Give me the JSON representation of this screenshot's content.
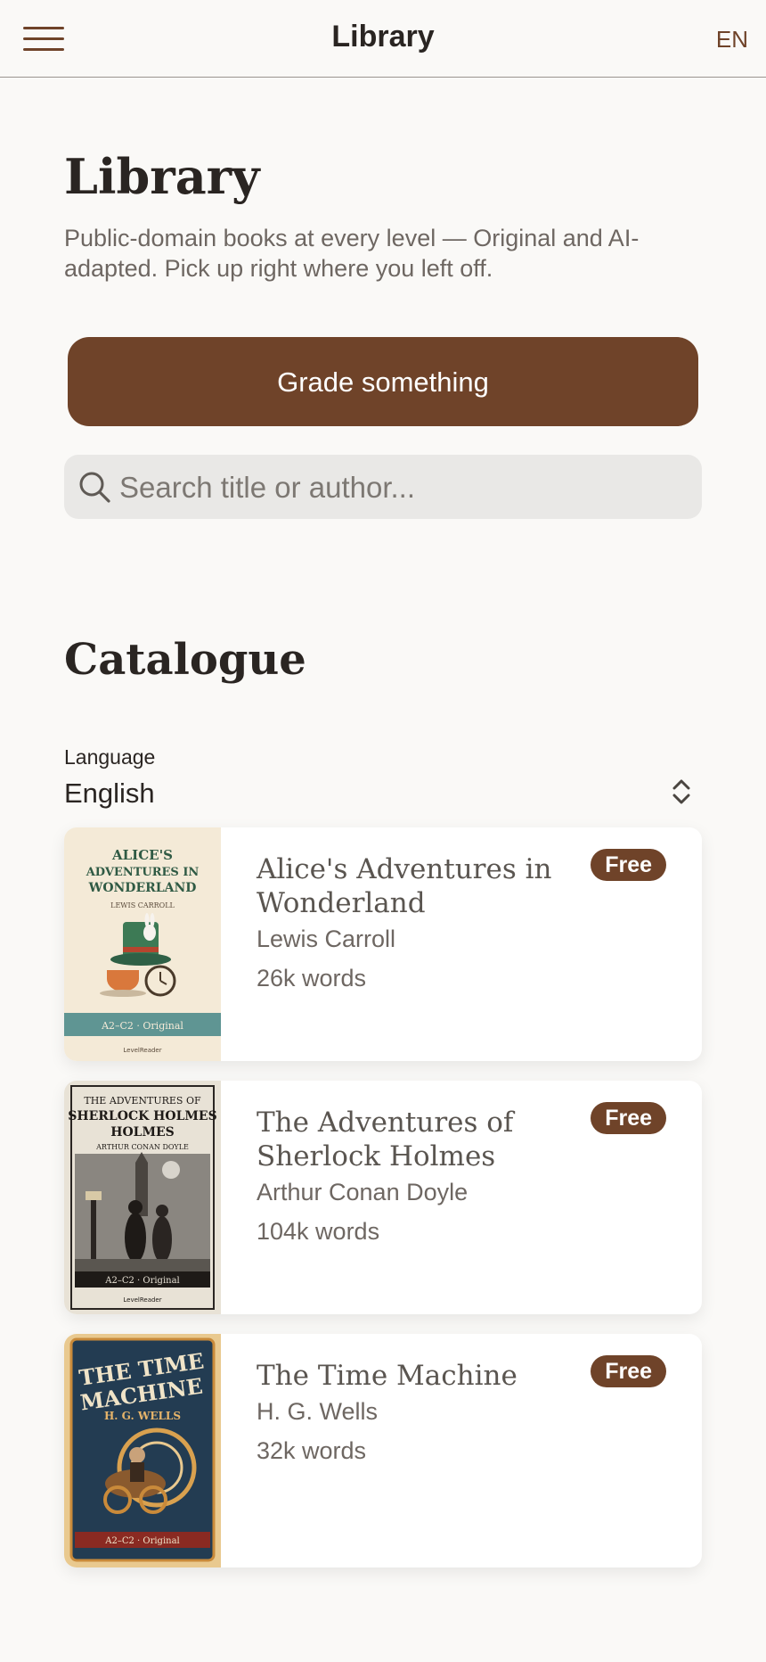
{
  "header": {
    "title": "Library",
    "language_code": "EN"
  },
  "intro": {
    "title": "Library",
    "subtitle": "Public-domain books at every level — Original and AI-adapted. Pick up right where you left off.",
    "grade_button": "Grade something",
    "search_placeholder": "Search title or author..."
  },
  "catalogue": {
    "title": "Catalogue",
    "language_label": "Language",
    "language_value": "English",
    "books": [
      {
        "title": "Alice's Adventures in Wonderland",
        "author": "Lewis Carroll",
        "words": "26k words",
        "badge": "Free",
        "cover": {
          "title_line1": "ALICE'S",
          "title_line2": "ADVENTURES IN",
          "title_line3": "WONDERLAND",
          "author": "LEWIS CARROLL",
          "level": "A2–C2 · Original",
          "brand": "LevelReader"
        }
      },
      {
        "title": "The Adventures of Sherlock Holmes",
        "author": "Arthur Conan Doyle",
        "words": "104k words",
        "badge": "Free",
        "cover": {
          "title_line1": "THE ADVENTURES OF",
          "title_line2": "SHERLOCK HOLMES",
          "title_line3": "HOLMES",
          "author": "ARTHUR CONAN DOYLE",
          "level": "A2–C2 · Original",
          "brand": "LevelReader"
        }
      },
      {
        "title": "The Time Machine",
        "author": "H. G. Wells",
        "words": "32k words",
        "badge": "Free",
        "cover": {
          "title_line1": "THE TIME",
          "title_line2": "MACHINE",
          "author": "H. G. WELLS",
          "level": "A2–C2 · Original"
        }
      }
    ]
  },
  "colors": {
    "accent": "#6f4329",
    "background": "#faf9f7",
    "card": "#ffffff"
  }
}
